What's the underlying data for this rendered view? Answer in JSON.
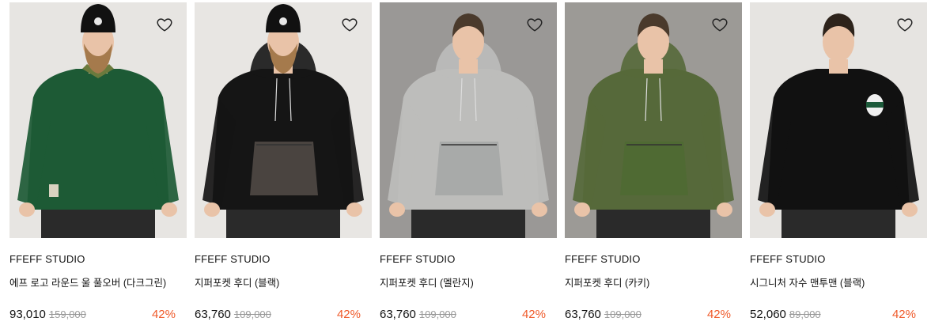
{
  "products": [
    {
      "brand": "FFEFF STUDIO",
      "name": "에프 로고 라운드 울 풀오버 (다크그린)",
      "price": "93,010",
      "original_price": "159,000",
      "discount": "42%",
      "bg_color": "#e7e5e2",
      "garment_color": "#1d5a35",
      "hair": "#b08a5c",
      "beanie": true,
      "beard": true
    },
    {
      "brand": "FFEFF STUDIO",
      "name": "지퍼포켓 후디 (블랙)",
      "price": "63,760",
      "original_price": "109,000",
      "discount": "42%",
      "bg_color": "#e8e6e3",
      "garment_color": "#151515",
      "hair": "#b08a5c",
      "beanie": true,
      "beard": true
    },
    {
      "brand": "FFEFF STUDIO",
      "name": "지퍼포켓 후디 (멜란지)",
      "price": "63,760",
      "original_price": "109,000",
      "discount": "42%",
      "bg_color": "#9a9896",
      "garment_color": "#bdbdbb",
      "hair": "#4a3a2c",
      "beanie": false,
      "beard": false
    },
    {
      "brand": "FFEFF STUDIO",
      "name": "지퍼포켓 후디 (카키)",
      "price": "63,760",
      "original_price": "109,000",
      "discount": "42%",
      "bg_color": "#9c9a96",
      "garment_color": "#56693a",
      "hair": "#4a3a2c",
      "beanie": false,
      "beard": false
    },
    {
      "brand": "FFEFF STUDIO",
      "name": "시그니처 자수 맨투맨 (블랙)",
      "price": "52,060",
      "original_price": "89,000",
      "discount": "42%",
      "bg_color": "#e6e4e1",
      "garment_color": "#111111",
      "hair": "#2d231b",
      "beanie": false,
      "beard": false
    }
  ],
  "icons": {
    "wishlist": "heart-outline-icon"
  },
  "colors": {
    "discount": "#ef5a2a",
    "strike": "#999999"
  }
}
